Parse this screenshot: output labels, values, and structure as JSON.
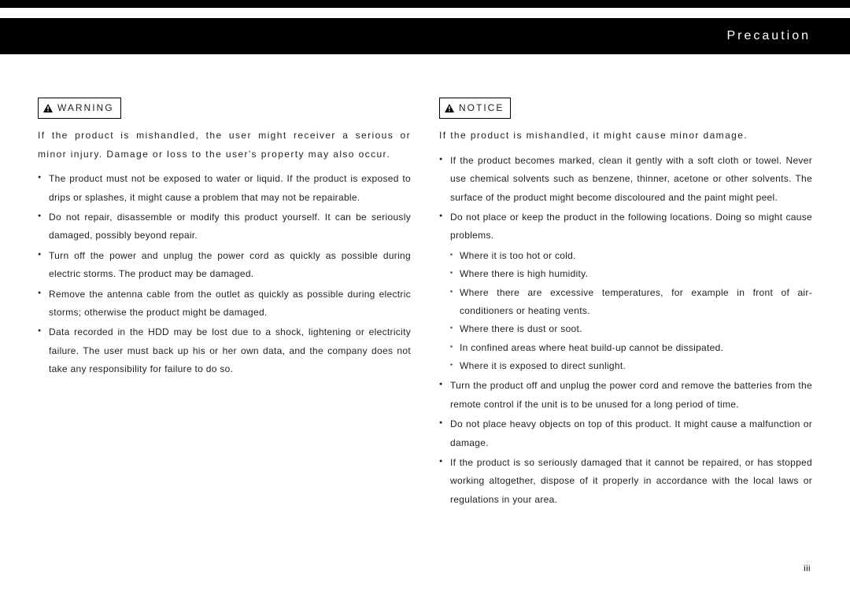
{
  "header": {
    "title": "Precaution"
  },
  "left": {
    "box_label": "WARNING",
    "intro": "If the product is mishandled, the user might receiver a serious or minor injury.  Damage or loss to the user's property may also occur.",
    "bullets": [
      "The product must not be exposed to water or liquid.  If the product is exposed to drips or splashes, it might cause a problem that may not be repairable.",
      "Do not repair, disassemble or modify this product yourself.  It can be seriously damaged, possibly beyond repair.",
      "Turn off the power and unplug the power cord as quickly as possible during electric storms.  The product may be damaged.",
      "Remove the antenna cable from the outlet as quickly as possible during electric storms; otherwise the product might be damaged.",
      "Data recorded in the HDD may be lost due to a shock, lightening or electricity failure.  The user must back up his or her own data, and the company does not take any responsibility for failure to do so."
    ]
  },
  "right": {
    "box_label": "NOTICE",
    "intro": "If the product is mishandled, it might cause minor damage.",
    "bullets": [
      {
        "text": "If the product becomes marked, clean it gently with a soft cloth or towel.  Never use chemical solvents such as benzene, thinner, acetone or other solvents.  The surface of the product might become discoloured and the paint might peel."
      },
      {
        "text": "Do not place or keep the product in the following locations.  Doing so might cause problems.",
        "sub": [
          "Where it is too hot or cold.",
          "Where there is high humidity.",
          "Where there are excessive temperatures, for example in front of air-conditioners or heating vents.",
          "Where there is dust or soot.",
          "In confined areas where heat build-up cannot be dissipated.",
          "Where it is exposed to direct sunlight."
        ]
      },
      {
        "text": "Turn the product off and unplug the power cord and remove the batteries from the remote control if the unit is to be unused for a long period of time."
      },
      {
        "text": "Do not place heavy objects on top of this product.  It might cause a malfunction or damage."
      },
      {
        "text": "If the product is so seriously damaged that it cannot be repaired, or has stopped working altogether, dispose of it properly in accordance with the local laws or regulations in your area."
      }
    ]
  },
  "page_number": "iii"
}
